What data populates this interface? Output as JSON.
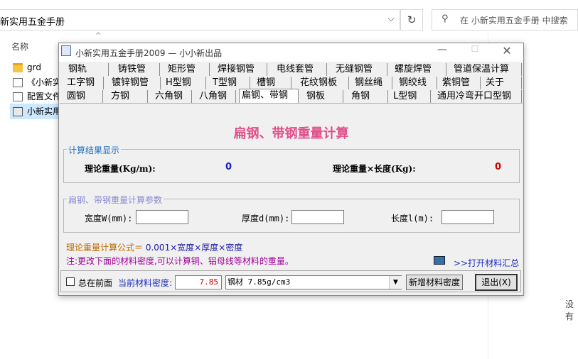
{
  "explorer": {
    "address": "新实用五金手册",
    "search_placeholder": "在 小新实用五金手册 中搜索",
    "column_name": "名称",
    "files": [
      "grd",
      "《小新实",
      "配置文件",
      "小新实用"
    ],
    "right_pane_text": "没有"
  },
  "window": {
    "title": "小新实用五金手册2009 — 小小新出品"
  },
  "tabs": {
    "row1": [
      "钢轨",
      "铸铁管",
      "矩形管",
      "焊接钢管",
      "电线套管",
      "无缝钢管",
      "螺旋焊管",
      "管道保温计算"
    ],
    "row2": [
      "工字钢",
      "镀锌钢管",
      "H型钢",
      "T型钢",
      "槽钢",
      "花纹钢板",
      "钢丝绳",
      "钢绞线",
      "紫铜管",
      "关于"
    ],
    "row3": [
      "圆钢",
      "方钢",
      "六角钢",
      "八角钢",
      "扁钢、带钢",
      "钢板",
      "角钢",
      "L型钢",
      "通用冷弯开口型钢"
    ],
    "active": "扁钢、带钢"
  },
  "main": {
    "heading": "扁钢、带钢重量计算",
    "result_group_title": "计算结果显示",
    "theoretical_weight_label": "理论重量(Kg/m):",
    "theoretical_weight_value": "0",
    "weight_length_label": "理论重量×长度(Kg):",
    "weight_length_value": "0",
    "param_group_title": "扁钢、带钢重量计算参数",
    "width_label": "宽度W(mm):",
    "width_value": "",
    "thickness_label": "厚度d(mm):",
    "thickness_value": "",
    "length_label": "长度l(m):",
    "length_value": "",
    "formula_prefix": "理论重量计算公式＝",
    "formula_body": "0.001×宽度×厚度×密度",
    "note": "注:更改下面的材料密度,可以计算铜、铝母线等材料的重量。",
    "summary_link": ">>打开材料汇总"
  },
  "bottom": {
    "always_on_top_label": "总在前面",
    "always_on_top_checked": false,
    "density_label": "当前材料密度:",
    "density_value": "7.85",
    "material_selected": "钢材 7.85g/cm3",
    "add_density_button": "新增材料密度",
    "exit_button": "退出(X)"
  },
  "colors": {
    "heading": "#e0508a",
    "group_title": "#1f6fbf",
    "param_group_title": "#8a8ad0",
    "value_blue": "#1a1acc",
    "value_red": "#cc0000",
    "formula_prefix": "#b86a00",
    "formula_body": "#1a1aa8",
    "note": "#a0009a"
  }
}
